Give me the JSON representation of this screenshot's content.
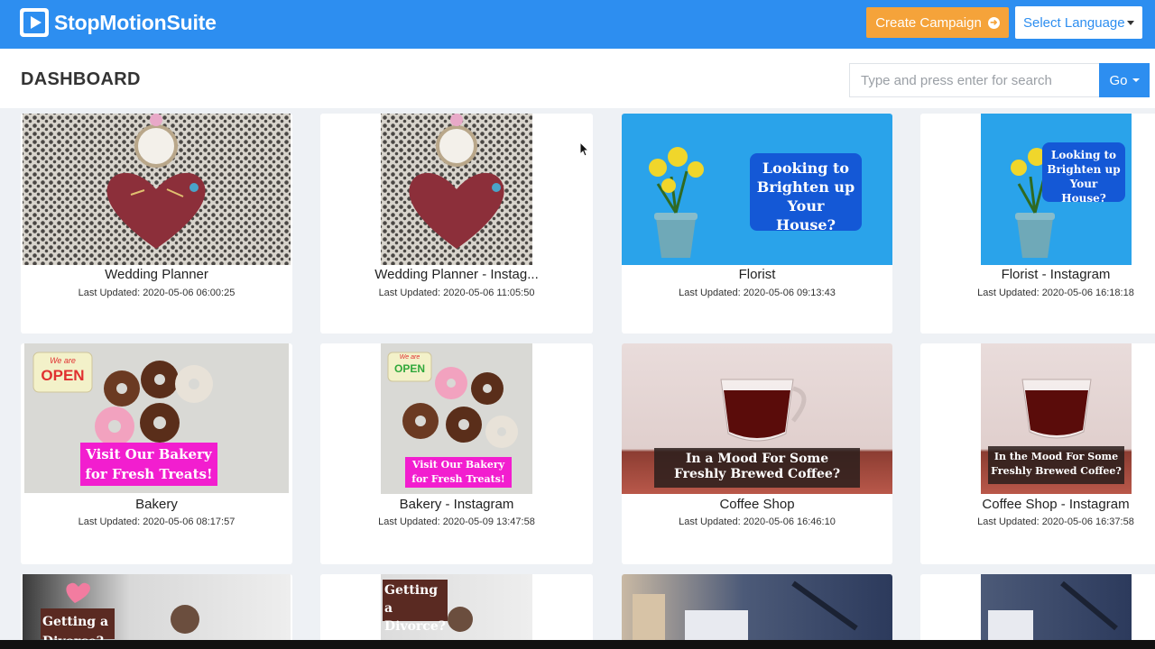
{
  "app": {
    "brand": "StopMotionSuite"
  },
  "nav": {
    "create_campaign": "Create Campaign",
    "language": "Select Language"
  },
  "page": {
    "title": "DASHBOARD"
  },
  "search": {
    "placeholder": "Type and press enter for search",
    "button": "Go"
  },
  "cards": [
    {
      "title": "Wedding Planner",
      "updated": "Last Updated: 2020-05-06 06:00:25",
      "thumb": "wedding"
    },
    {
      "title": "Wedding Planner - Instag...",
      "updated": "Last Updated: 2020-05-06 11:05:50",
      "thumb": "wedding"
    },
    {
      "title": "Florist",
      "updated": "Last Updated: 2020-05-06 09:13:43",
      "thumb": "florist",
      "overlay": "Looking to Brighten up Your House?"
    },
    {
      "title": "Florist - Instagram",
      "updated": "Last Updated: 2020-05-06 16:18:18",
      "thumb": "florist",
      "overlay": "Looking to Brighten up Your House?"
    },
    {
      "title": "Bakery",
      "updated": "Last Updated: 2020-05-06 08:17:57",
      "thumb": "bakery",
      "badge_top": "We are",
      "badge_main": "OPEN",
      "overlay": "Visit Our Bakery for Fresh Treats!"
    },
    {
      "title": "Bakery - Instagram",
      "updated": "Last Updated: 2020-05-09 13:47:58",
      "thumb": "bakery",
      "badge_top": "We are",
      "badge_main": "OPEN",
      "overlay": "Visit Our Bakery for Fresh Treats!"
    },
    {
      "title": "Coffee Shop",
      "updated": "Last Updated: 2020-05-06 16:46:10",
      "thumb": "coffee",
      "overlay": "In a Mood For Some Freshly Brewed Coffee?"
    },
    {
      "title": "Coffee Shop - Instagram",
      "updated": "Last Updated: 2020-05-06 16:37:58",
      "thumb": "coffee",
      "overlay": "In the Mood For Some Freshly Brewed Coffee?"
    },
    {
      "thumb": "divorce",
      "overlay": "Getting a Divorce?"
    },
    {
      "thumb": "divorce",
      "overlay": "Getting a Divorce?"
    },
    {
      "thumb": "office"
    },
    {
      "thumb": "office"
    }
  ],
  "colors": {
    "navbar": "#2d8ef0",
    "campaign_button": "#f5a33a",
    "background": "#eef1f5"
  }
}
